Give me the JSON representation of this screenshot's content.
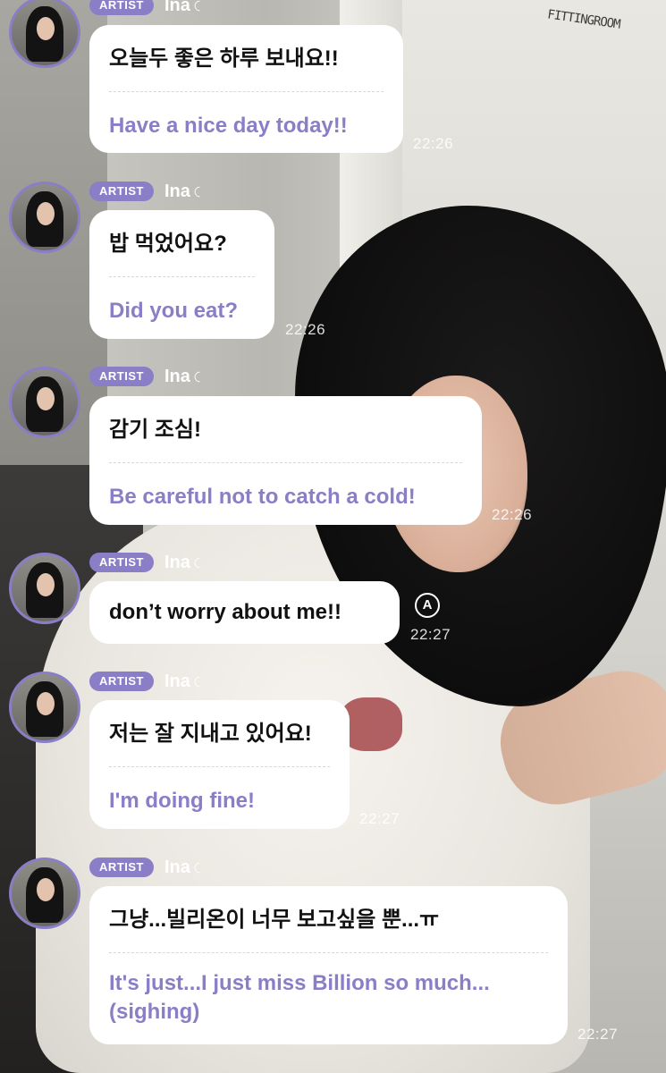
{
  "background_text": "FITTINGROOM",
  "colors": {
    "accent": "#8a7ec6",
    "bubble": "#ffffff",
    "korean_text": "#111111",
    "translation_text": "#8a7ec6"
  },
  "messages": [
    {
      "badge": "ARTIST",
      "sender": "Ina",
      "korean": "오늘두 좋은 하루 보내요!!",
      "english": "Have a nice day today!!",
      "time": "22:26"
    },
    {
      "badge": "ARTIST",
      "sender": "Ina",
      "korean": "밥 먹었어요?",
      "english": "Did you eat?",
      "time": "22:26"
    },
    {
      "badge": "ARTIST",
      "sender": "Ina",
      "korean": "감기 조심!",
      "english": "Be careful not to catch a cold!",
      "time": "22:26"
    },
    {
      "badge": "ARTIST",
      "sender": "Ina",
      "korean": "don’t worry about me!!",
      "translate_icon": "A",
      "time": "22:27"
    },
    {
      "badge": "ARTIST",
      "sender": "Ina",
      "korean": "저는 잘 지내고 있어요!",
      "english": "I'm doing fine!",
      "time": "22:27"
    },
    {
      "badge": "ARTIST",
      "sender": "Ina",
      "korean": "그냥...빌리온이 너무 보고싶을 뿐...ㅠ",
      "english": "It's just...I just miss Billion so much...(sighing)",
      "time": "22:27"
    }
  ]
}
